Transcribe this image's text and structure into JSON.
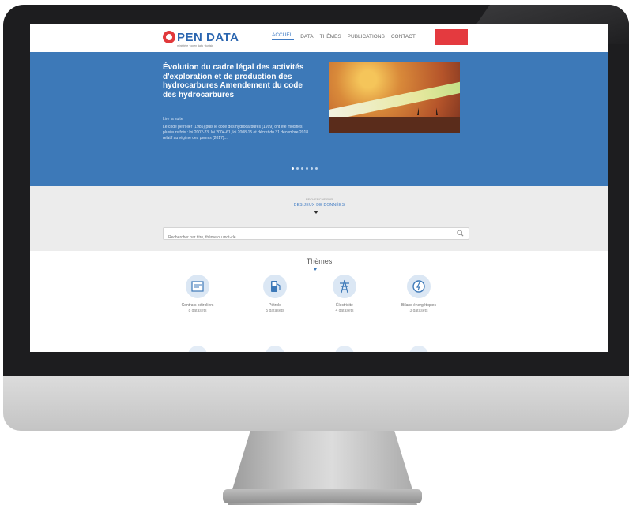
{
  "app": {
    "logo_text": "PEN DATA",
    "logo_subtitle": "ministère · open data · tunisie"
  },
  "nav": {
    "items": [
      {
        "label": "ACCUEIL",
        "active": true
      },
      {
        "label": "DATA",
        "active": false
      },
      {
        "label": "THÈMES",
        "active": false
      },
      {
        "label": "PUBLICATIONS",
        "active": false
      },
      {
        "label": "CONTACT",
        "active": false
      }
    ],
    "cta_label": "",
    "cta_color": "#e43a3f"
  },
  "hero": {
    "title": "Évolution du cadre légal des activités d'exploration et de production des hydrocarbures Amendement du code des hydrocarbures",
    "link": "Lire la suite",
    "text": "Le code pétrolier (1985) puis le code des hydrocarbures (1999) ont été modifiés plusieurs fois : loi 2002-23, loi 2004-61, loi 2008-15 et décret du 31 décembre 2018 relatif au régime des permis (2017)...",
    "slides_total": 6,
    "slide_active": 1,
    "background_color": "#3d79b8"
  },
  "search": {
    "kicker": "RECHERCHE PAR",
    "heading": "DES JEUX DE DONNÉES",
    "placeholder": "Rechercher par titre, thème ou mot-clé"
  },
  "themes": {
    "title": "Thèmes",
    "items": [
      {
        "label": "Contrats pétroliers",
        "count": "8 datasets",
        "icon": "contract-icon"
      },
      {
        "label": "Pétrole",
        "count": "5 datasets",
        "icon": "fuel-pump-icon"
      },
      {
        "label": "Électricité",
        "count": "4 datasets",
        "icon": "power-pylon-icon"
      },
      {
        "label": "Bilans énergétiques",
        "count": "3 datasets",
        "icon": "energy-gauge-icon"
      }
    ],
    "accent_color": "#3d79b8"
  }
}
